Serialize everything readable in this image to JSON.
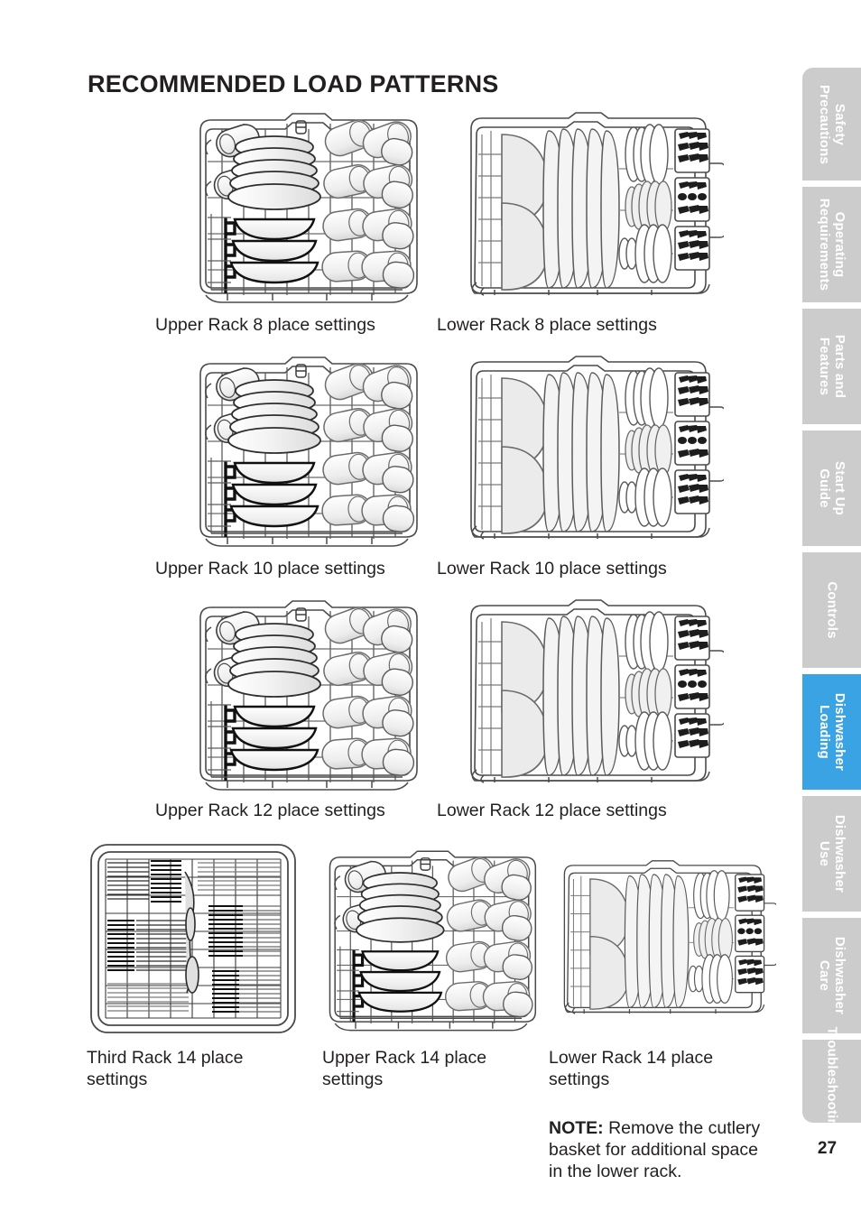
{
  "document": {
    "title": "RECOMMENDED LOAD PATTERNS",
    "page_number": "27"
  },
  "figures": [
    {
      "id": "upper-rack-8",
      "caption": "Upper Rack 8 place settings",
      "rack": "upper",
      "settings": 8
    },
    {
      "id": "lower-rack-8",
      "caption": "Lower Rack 8 place settings",
      "rack": "lower",
      "settings": 8
    },
    {
      "id": "upper-rack-10",
      "caption": "Upper Rack 10 place settings",
      "rack": "upper",
      "settings": 10
    },
    {
      "id": "lower-rack-10",
      "caption": "Lower Rack 10 place settings",
      "rack": "lower",
      "settings": 10
    },
    {
      "id": "upper-rack-12",
      "caption": "Upper Rack 12 place settings",
      "rack": "upper",
      "settings": 12
    },
    {
      "id": "lower-rack-12",
      "caption": "Lower Rack 12 place settings",
      "rack": "lower",
      "settings": 12
    },
    {
      "id": "third-rack-14",
      "caption": "Third Rack 14 place\nsettings",
      "rack": "third",
      "settings": 14
    },
    {
      "id": "upper-rack-14",
      "caption": "Upper Rack 14 place\nsettings",
      "rack": "upper",
      "settings": 14
    },
    {
      "id": "lower-rack-14",
      "caption": "Lower Rack 14 place\nsettings",
      "rack": "lower",
      "settings": 14
    }
  ],
  "note": {
    "label": "NOTE:",
    "text": " Remove the cutlery basket for additional space in the lower rack."
  },
  "sidebar": {
    "active_color": "#39A3E3",
    "inactive_color": "#CCCCCC",
    "text_color": "#FFFFFF",
    "tabs": [
      {
        "label": "Safety\nPrecautions",
        "active": false
      },
      {
        "label": "Operating\nRequirements",
        "active": false
      },
      {
        "label": "Parts and\nFeatures",
        "active": false
      },
      {
        "label": "Start Up\nGuide",
        "active": false
      },
      {
        "label": "Controls",
        "active": false
      },
      {
        "label": "Dishwasher\nLoading",
        "active": true
      },
      {
        "label": "Dishwasher\nUse",
        "active": false
      },
      {
        "label": "Dishwasher\nCare",
        "active": false
      },
      {
        "label": "Troubleshooting",
        "active": false
      }
    ]
  }
}
